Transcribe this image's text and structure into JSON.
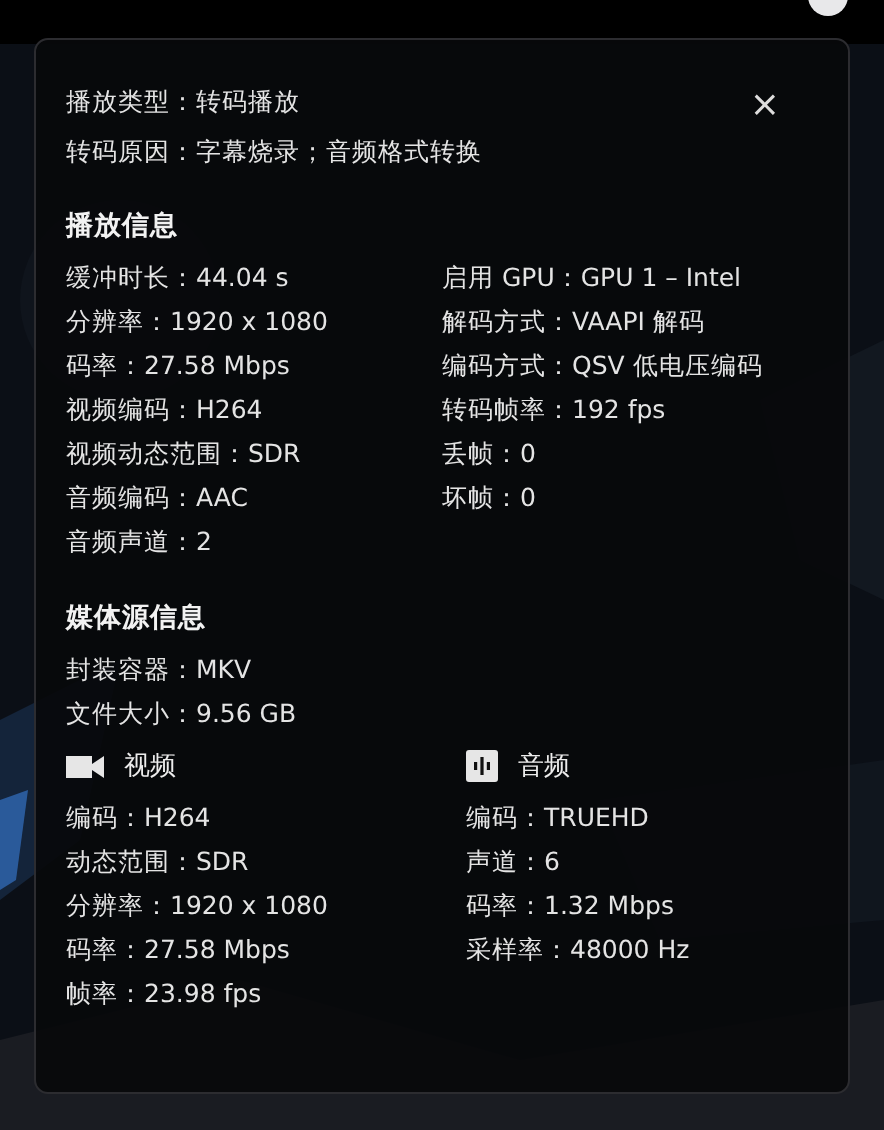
{
  "playback_type": "播放类型：转码播放",
  "close_button": "×",
  "transcode_reason": "转码原因：字幕烧录；音频格式转换",
  "playback_info": {
    "title": "播放信息",
    "left": [
      "缓冲时长：44.04 s",
      "分辨率：1920 x 1080",
      "码率：27.58 Mbps",
      "视频编码：H264",
      "视频动态范围：SDR",
      "音频编码：AAC",
      "音频声道：2"
    ],
    "right": [
      "启用 GPU：GPU 1 – Intel",
      "解码方式：VAAPI 解码",
      "编码方式：QSV 低电压编码",
      "转码帧率：192 fps",
      "丢帧：0",
      "坏帧：0"
    ]
  },
  "media_source": {
    "title": "媒体源信息",
    "items": [
      "封装容器：MKV",
      "文件大小：9.56 GB"
    ],
    "streams": [
      {
        "kind": "video",
        "title": "视频",
        "items": [
          "编码：H264",
          "动态范围：SDR",
          "分辨率：1920 x 1080",
          "码率：27.58 Mbps",
          "帧率：23.98 fps"
        ]
      },
      {
        "kind": "audio",
        "title": "音频",
        "items": [
          "编码：TRUEHD",
          "声道：6",
          "码率：1.32 Mbps",
          "采样率：48000 Hz"
        ]
      }
    ]
  }
}
